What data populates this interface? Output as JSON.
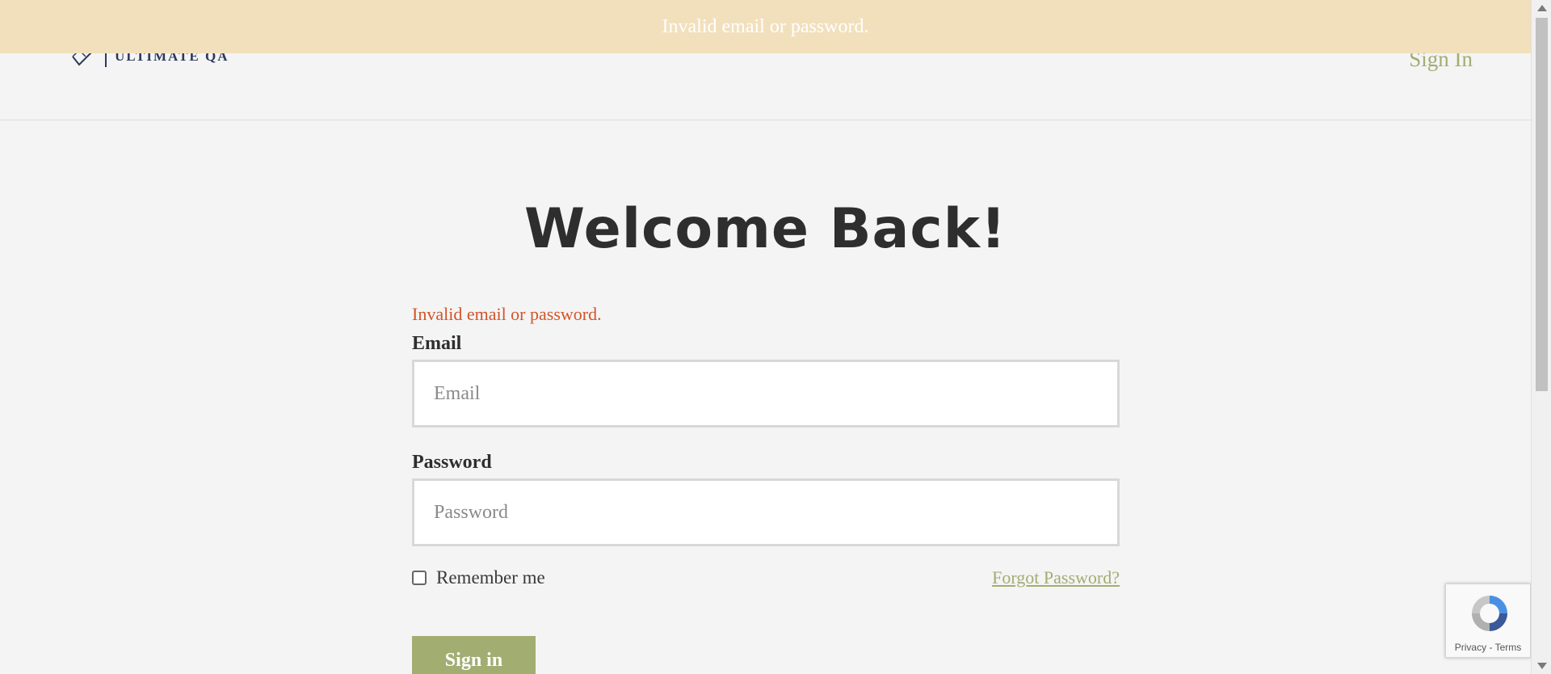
{
  "flash": {
    "message": "Invalid email or password."
  },
  "header": {
    "logo_text": "ULTIMATE QA",
    "sign_in_link": "Sign In"
  },
  "main": {
    "title": "Welcome Back!",
    "error_message": "Invalid email or password.",
    "email": {
      "label": "Email",
      "placeholder": "Email",
      "value": ""
    },
    "password": {
      "label": "Password",
      "placeholder": "Password",
      "value": ""
    },
    "remember_me": {
      "label": "Remember me",
      "checked": false
    },
    "forgot_password": "Forgot Password?",
    "submit_label": "Sign in"
  },
  "recaptcha": {
    "privacy": "Privacy",
    "separator": " - ",
    "terms": "Terms"
  },
  "colors": {
    "accent": "#a2ad72",
    "flash_bg": "#f2e0bd",
    "error": "#d35428",
    "logo": "#2d3a5c"
  },
  "icons": {
    "logo": "checkmark-icon",
    "recaptcha": "recaptcha-icon"
  }
}
